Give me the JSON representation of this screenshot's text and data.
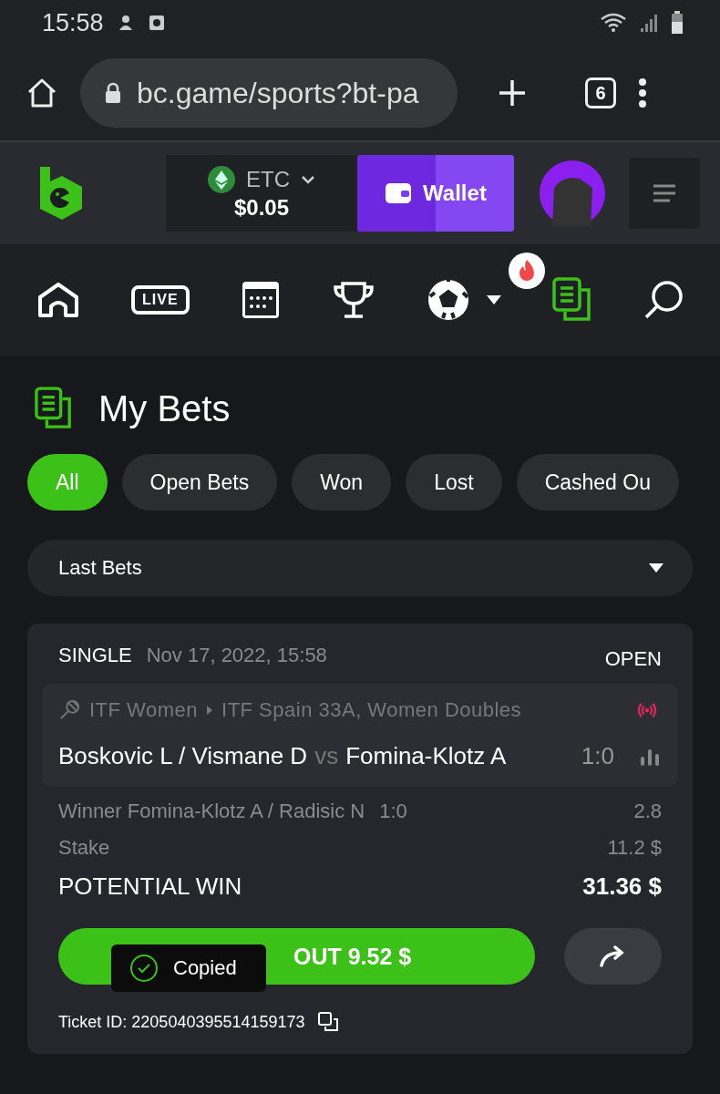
{
  "status_bar": {
    "time": "15:58"
  },
  "browser": {
    "url": "bc.game/sports?bt-pa",
    "tab_count": "6"
  },
  "header": {
    "currency": "ETC",
    "balance": "$0.05",
    "wallet_label": "Wallet"
  },
  "nav": [
    {
      "kind": "home",
      "selected": false
    },
    {
      "kind": "live",
      "label": "LIVE",
      "selected": false
    },
    {
      "kind": "calendar",
      "selected": false
    },
    {
      "kind": "trophy",
      "selected": false
    },
    {
      "kind": "soccer",
      "selected": false
    },
    {
      "kind": "bets",
      "selected": true
    },
    {
      "kind": "search",
      "selected": false
    }
  ],
  "page_title": "My Bets",
  "filters": [
    {
      "label": "All",
      "selected": true
    },
    {
      "label": "Open Bets",
      "selected": false
    },
    {
      "label": "Won",
      "selected": false
    },
    {
      "label": "Lost",
      "selected": false
    },
    {
      "label": "Cashed Ou",
      "selected": false
    }
  ],
  "dropdown": {
    "value": "Last Bets"
  },
  "bet": {
    "type": "SINGLE",
    "date": "Nov 17, 2022, 15:58",
    "status": "OPEN",
    "league": "ITF Women",
    "tournament": "ITF Spain 33A, Women Doubles",
    "live": true,
    "home": "Boskovic L / Vismane D",
    "vs": "vs",
    "away": "Fomina-Klotz A",
    "score": "1:0",
    "selection": "Winner Fomina-Klotz A / Radisic N",
    "selection_score": "1:0",
    "odds": "2.8",
    "stake_label": "Stake",
    "stake": "11.2 $",
    "win_label": "POTENTIAL WIN",
    "win": "31.36 $",
    "cashout_label": "OUT 9.52 $",
    "ticket": "Ticket ID: 2205040395514159173"
  },
  "toast": {
    "text": "Copied"
  }
}
